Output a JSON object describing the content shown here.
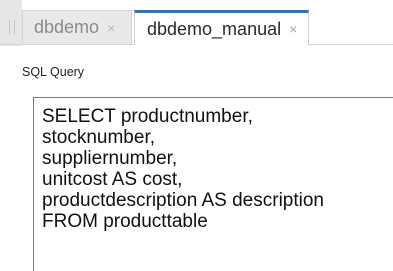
{
  "tabs": [
    {
      "label": "dbdemo",
      "close_glyph": "×",
      "active": false
    },
    {
      "label": "dbdemo_manual",
      "close_glyph": "×",
      "active": true
    }
  ],
  "colors": {
    "active_tab_accent": "#3376b8",
    "inactive_tab_bg": "#e9e9e9",
    "gutter_bg": "#e6e6e6"
  },
  "query_panel": {
    "label": "SQL Query",
    "lines": [
      "SELECT productnumber,",
      "stocknumber,",
      "suppliernumber,",
      "unitcost AS cost,",
      "productdescription AS description",
      "FROM producttable"
    ]
  },
  "icons": {
    "tab_close": "close-icon",
    "drag_handle": "grip-handle-icon"
  }
}
